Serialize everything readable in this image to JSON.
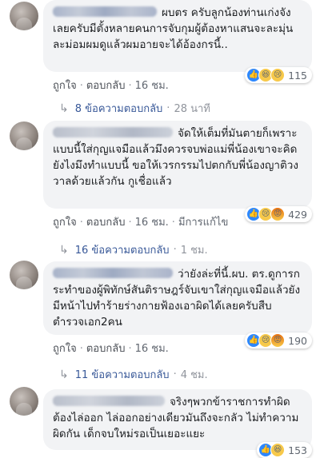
{
  "comments": [
    {
      "text": "ผบตร ครับลูกน้องท่านเก่งจังเลยครับมีตั้งหลายคนการจับกุมผู้ต้องหาแสนจะละมุ่นละม่อมผมดูแล้วผมอายจะได้อ้องกรนี้..",
      "reactions": [
        "like-icon",
        "haha-icon",
        "sad-icon"
      ],
      "reaction_count": "115",
      "like": "ถูกใจ",
      "reply": "ตอบกลับ",
      "time": "16 ชม.",
      "replies_label": "8 ข้อความตอบกลับ",
      "replies_time": "28 นาที"
    },
    {
      "text": "จัดให้เต็มที่มันตายก็เพราะแบบนี้ใส่กุญแจมือแล้วมึงควรจบพ่อแม่พี่น้องเขาจะคิดยังไงมึงทำแบบนี้ ขอให้เวรกรรมไปตกกับพี่น้องญาติวงวาลด้วยแล้วกัน กูเชื่อแล้ว",
      "name_partial": "Ven Arsoonaascon",
      "reactions": [
        "like-icon",
        "sad-icon",
        "angry-icon"
      ],
      "reaction_count": "429",
      "like": "ถูกใจ",
      "reply": "ตอบกลับ",
      "time": "16 ชม.",
      "edited": "มีการแก้ไข",
      "replies_label": "16 ข้อความตอบกลับ",
      "replies_time": "1 ชม."
    },
    {
      "text": "ว่ายังล่ะที่นี้.ผบ. ตร.ดูการกระทำของผู้พิทักษ์สันติราษฎร์จับเขาใส่กุญแจมือแล้วยังมีหน้าไปทำร้ายร่างกายฟ้องเอาผิดได้เลยครับสืบตำรวจเอก2คน",
      "reactions": [
        "like-icon",
        "sad-icon",
        "angry-icon"
      ],
      "reaction_count": "190",
      "like": "ถูกใจ",
      "reply": "ตอบกลับ",
      "time": "16 ชม.",
      "replies_label": "11 ข้อความตอบกลับ",
      "replies_time": "4 ชม."
    },
    {
      "text": "จริงๆพวกข้าราชการทำผิดต้องไล่ออก ไล่ออกอย่างเดียวมันถึงจะกลัว ไม่ทำความผิดกัน เด็กจบใหม่รอเป็นเยอะแยะ",
      "reaction_count": "153"
    }
  ]
}
